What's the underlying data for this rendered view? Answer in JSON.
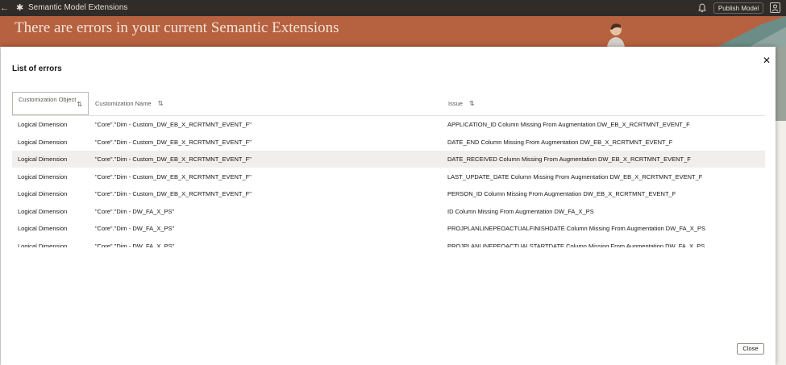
{
  "app": {
    "title": "Semantic Model Extensions",
    "publish_label": "Publish Model"
  },
  "banner": {
    "title": "There are errors in your current Semantic Extensions"
  },
  "modal": {
    "title": "List of errors",
    "close_label": "Close",
    "columns": {
      "object": "Customization Object",
      "name": "Customization Name",
      "issue": "Issue"
    },
    "rows": [
      {
        "object": "Logical Dimension",
        "name": "\"Core\".\"Dim - Custom_DW_EB_X_RCRTMNT_EVENT_F\"",
        "issue": "APPLICATION_ID Column Missing From Augmentation DW_EB_X_RCRTMNT_EVENT_F"
      },
      {
        "object": "Logical Dimension",
        "name": "\"Core\".\"Dim - Custom_DW_EB_X_RCRTMNT_EVENT_F\"",
        "issue": "DATE_END Column Missing From Augmentation DW_EB_X_RCRTMNT_EVENT_F"
      },
      {
        "object": "Logical Dimension",
        "name": "\"Core\".\"Dim - Custom_DW_EB_X_RCRTMNT_EVENT_F\"",
        "issue": "DATE_RECEIVED Column Missing From Augmentation DW_EB_X_RCRTMNT_EVENT_F"
      },
      {
        "object": "Logical Dimension",
        "name": "\"Core\".\"Dim - Custom_DW_EB_X_RCRTMNT_EVENT_F\"",
        "issue": "LAST_UPDATE_DATE Column Missing From Augmentation DW_EB_X_RCRTMNT_EVENT_F"
      },
      {
        "object": "Logical Dimension",
        "name": "\"Core\".\"Dim - Custom_DW_EB_X_RCRTMNT_EVENT_F\"",
        "issue": "PERSON_ID Column Missing From Augmentation DW_EB_X_RCRTMNT_EVENT_F"
      },
      {
        "object": "Logical Dimension",
        "name": "\"Core\".\"Dim - DW_FA_X_PS\"",
        "issue": "ID Column Missing From Augmentation DW_FA_X_PS"
      },
      {
        "object": "Logical Dimension",
        "name": "\"Core\".\"Dim - DW_FA_X_PS\"",
        "issue": "PROJPLANLINEPEOACTUALFINISHDATE Column Missing From Augmentation DW_FA_X_PS"
      },
      {
        "object": "Logical Dimension",
        "name": "\"Core\".\"Dim - DW_FA_X_PS\"",
        "issue": "PROJPLANLINEPEOACTUALSTARTDATE Column Missing From Augmentation DW_FA_X_PS"
      }
    ]
  },
  "icons": {
    "back": "back-arrow-icon",
    "logo": "snowflake-icon",
    "bell": "bell-icon",
    "avatar": "user-icon",
    "close": "close-icon",
    "sort": "sort-icon"
  }
}
